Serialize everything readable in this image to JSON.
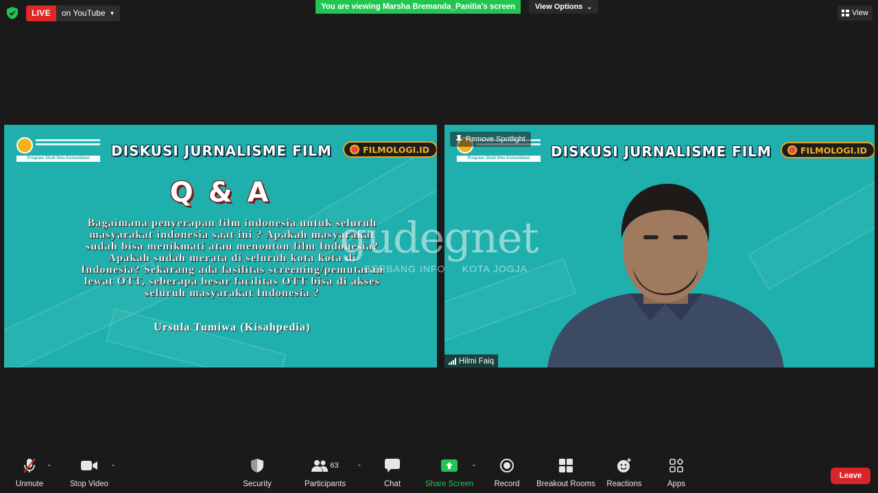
{
  "top_bar": {
    "live_label": "LIVE",
    "live_destination": "on YouTube",
    "viewing_banner": "You are viewing Marsha Bremanda_Panitia's screen",
    "view_options_label": "View Options",
    "view_label": "View"
  },
  "slide": {
    "title": "DISKUSI JURNALISME FILM",
    "brand": "FILMOLOGI.ID",
    "logo_program": "Program Studi Ilmu Komunikasi",
    "qa_title": "Q & A",
    "question_lines": [
      "Bagaimana penyerapan film indonesia untuk seluruh",
      "masyarakat indonesia saat ini ? Apakah masyarakat",
      "sudah bisa menikmati atau menonton film Indonesia?",
      "Apakah sudah merata di seluruh kota kota di",
      "Indonesia? Sekarang ada fasilitas screening/pemutaran",
      "lewat OTT, seberapa besar facilitas OTT bisa di akses",
      "seluruh masyarakat Indonesia ?"
    ],
    "author": "Ursula Tumiwa (Kisahpedia)"
  },
  "participant_video": {
    "remove_spotlight_label": "Remove Spotlight",
    "participant_name": "Hilmi Faiq"
  },
  "watermark": {
    "main": "gudegnet",
    "sub": "GERBANG INFO     KOTA JOGJA"
  },
  "toolbar": {
    "unmute": "Unmute",
    "stop_video": "Stop Video",
    "security": "Security",
    "participants": "Participants",
    "participants_count": "63",
    "chat": "Chat",
    "share_screen": "Share Screen",
    "record": "Record",
    "breakout_rooms": "Breakout Rooms",
    "reactions": "Reactions",
    "apps": "Apps",
    "leave": "Leave"
  },
  "colors": {
    "background": "#1a1a1a",
    "slide_teal": "#1fb0ad",
    "live_red": "#e02828",
    "share_green": "#23c552",
    "leave_red": "#d9252a"
  }
}
